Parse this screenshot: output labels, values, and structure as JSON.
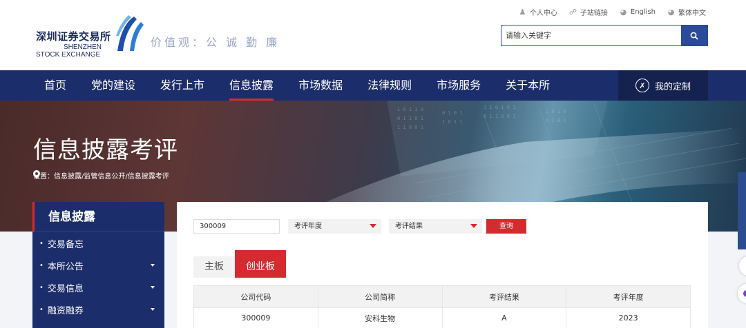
{
  "header": {
    "logo_cn": "深圳证券交易所",
    "logo_en_line1": "SHENZHEN",
    "logo_en_line2": "STOCK EXCHANGE",
    "slogan": "价值观：公 诚 勤 廉",
    "links": [
      {
        "label": "个人中心",
        "icon": "user-icon"
      },
      {
        "label": "子站链接",
        "icon": "link-icon"
      },
      {
        "label": "English",
        "icon": "globe-icon"
      },
      {
        "label": "繁体中文",
        "icon": "globe-icon"
      }
    ],
    "search_placeholder": "请输入关键字"
  },
  "nav": {
    "items": [
      "首页",
      "党的建设",
      "发行上市",
      "信息披露",
      "市场数据",
      "法律规则",
      "市场服务",
      "关于本所"
    ],
    "active_index": 3,
    "custom_label": "我的定制"
  },
  "banner": {
    "title": "信息披露考评",
    "breadcrumb": "位置：信息披露/监管信息公开/信息披露考评"
  },
  "sidebar": {
    "title": "信息披露",
    "items": [
      {
        "label": "交易备忘",
        "has_caret": false
      },
      {
        "label": "本所公告",
        "has_caret": true
      },
      {
        "label": "交易信息",
        "has_caret": true
      },
      {
        "label": "融资融券",
        "has_caret": true
      }
    ]
  },
  "filters": {
    "code_value": "300009",
    "year_label": "考评年度",
    "result_label": "考评结果",
    "query_label": "查询"
  },
  "tabs": [
    "主板",
    "创业板"
  ],
  "active_tab": 1,
  "table": {
    "headers": [
      "公司代码",
      "公司简称",
      "考评结果",
      "考评年度"
    ],
    "rows": [
      [
        "300009",
        "安科生物",
        "A",
        "2023"
      ]
    ]
  },
  "colors": {
    "nav": "#1c2d6b",
    "accent": "#d52b30",
    "search_btn": "#2c4a9a"
  }
}
